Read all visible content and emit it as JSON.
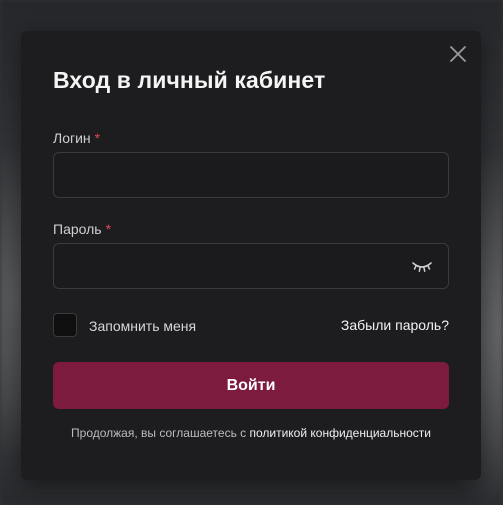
{
  "modal": {
    "title": "Вход в личный кабинет",
    "close_icon": "close-icon"
  },
  "login": {
    "label": "Логин",
    "required_mark": "*",
    "value": "",
    "placeholder": ""
  },
  "password": {
    "label": "Пароль",
    "required_mark": "*",
    "value": "",
    "placeholder": "",
    "toggle_icon": "eye-closed-icon"
  },
  "remember": {
    "label": "Запомнить меня",
    "checked": false
  },
  "forgot_label": "Забыли пароль?",
  "submit_label": "Войти",
  "terms": {
    "prefix": "Продолжая, вы соглашаетесь с ",
    "link": "политикой конфиденциальности"
  },
  "colors": {
    "modal_bg": "#1d1d1f",
    "accent": "#7d1b3f",
    "required": "#e0485a"
  }
}
